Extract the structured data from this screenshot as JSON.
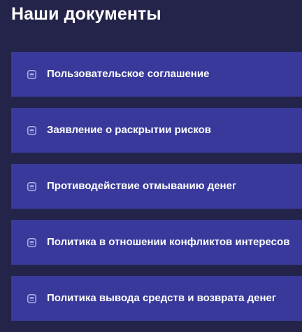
{
  "page": {
    "title": "Наши документы"
  },
  "documents": {
    "icon": "document-icon",
    "items": [
      {
        "label": "Пользовательское соглашение"
      },
      {
        "label": "Заявление о раскрытии рисков"
      },
      {
        "label": "Противодействие отмыванию денег"
      },
      {
        "label": "Политика в отношении конфликтов интересов"
      },
      {
        "label": "Политика вывода средств и возврата денег"
      }
    ]
  },
  "colors": {
    "background": "#24244a",
    "card": "#39399b",
    "icon": "#aeb0ea",
    "text": "#ffffff"
  }
}
